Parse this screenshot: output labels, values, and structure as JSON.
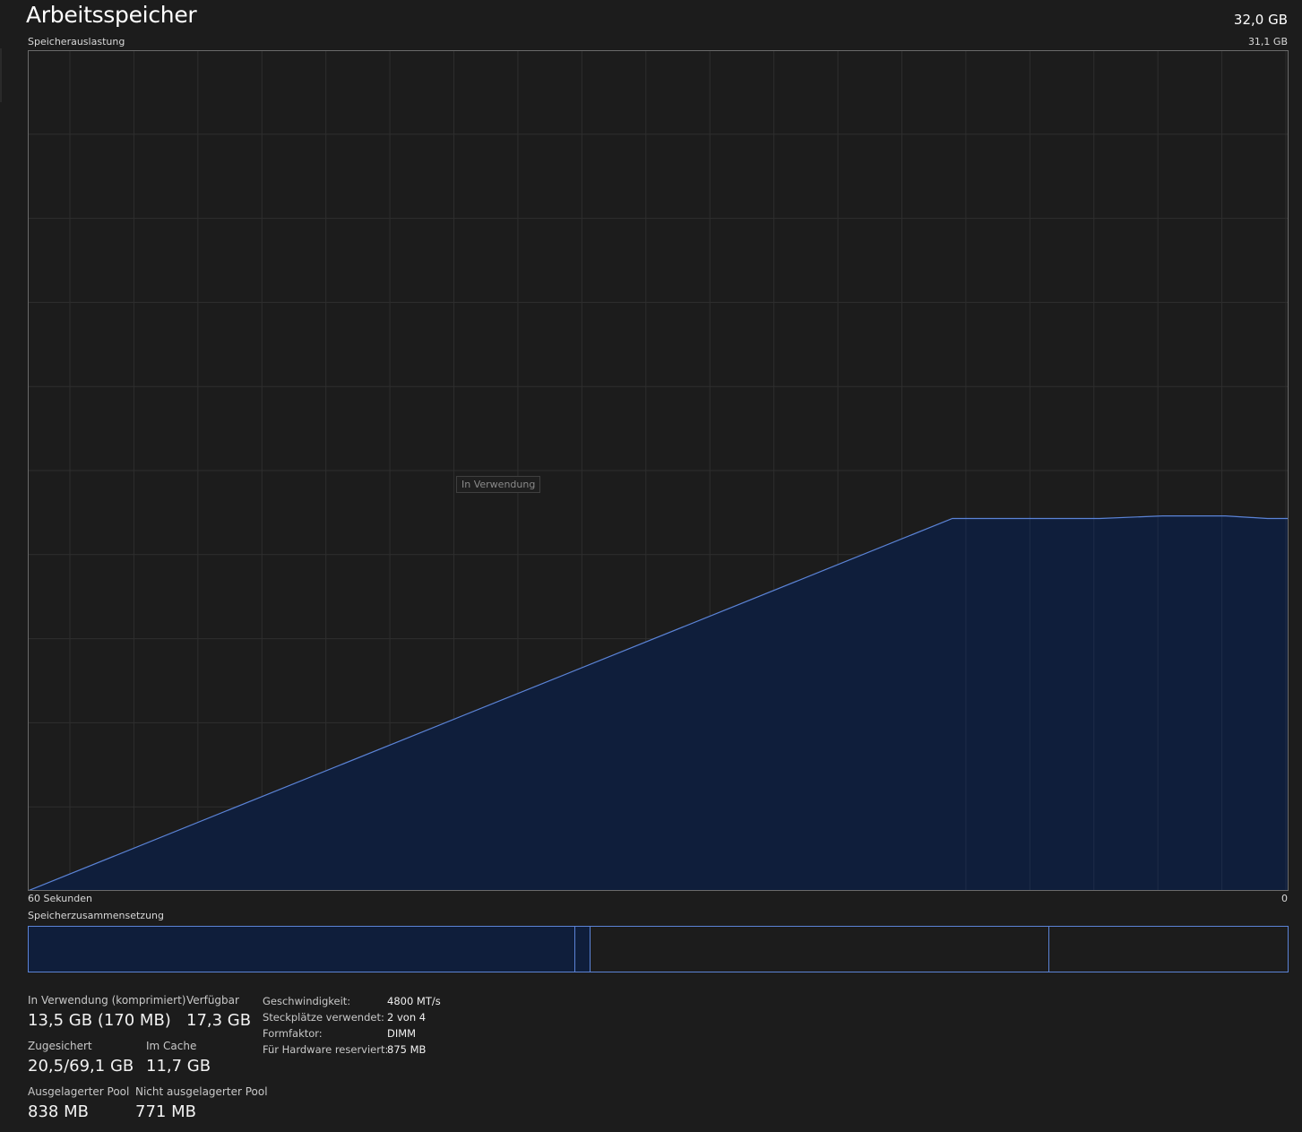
{
  "header": {
    "title": "Arbeitsspeicher",
    "total": "32,0 GB",
    "usage_label": "Speicherauslastung",
    "usage_max": "31,1 GB"
  },
  "graph": {
    "time_left": "60 Sekunden",
    "time_right": "0",
    "tooltip": "In Verwendung",
    "line_color": "#5b83d6",
    "fill_color": "#0f1e3b",
    "grid_color": "#2e2e2e"
  },
  "chart_data": {
    "type": "area",
    "x": [
      60,
      16,
      15,
      12,
      9,
      6,
      3,
      1,
      0
    ],
    "y_fraction_of_max": [
      0.0,
      0.443,
      0.443,
      0.443,
      0.443,
      0.446,
      0.446,
      0.443,
      0.443
    ],
    "ylim": [
      0,
      1
    ],
    "xlim": [
      60,
      0
    ],
    "grid": true
  },
  "composition": {
    "label": "Speicherzusammensetzung",
    "segments_fraction": [
      0.434,
      0.012,
      0.365,
      0.189
    ]
  },
  "stats": {
    "in_use_label": "In Verwendung (komprimiert)",
    "in_use_value": "13,5 GB (170 MB)",
    "available_label": "Verfügbar",
    "available_value": "17,3 GB",
    "committed_label": "Zugesichert",
    "committed_value": "20,5/69,1 GB",
    "cached_label": "Im Cache",
    "cached_value": "11,7 GB",
    "paged_label": "Ausgelagerter Pool",
    "paged_value": "838 MB",
    "nonpaged_label": "Nicht ausgelagerter Pool",
    "nonpaged_value": "771 MB"
  },
  "specs": [
    {
      "label": "Geschwindigkeit:",
      "value": "4800 MT/s"
    },
    {
      "label": "Steckplätze verwendet:",
      "value": "2 von 4"
    },
    {
      "label": "Formfaktor:",
      "value": "DIMM"
    },
    {
      "label": "Für Hardware reserviert:",
      "value": "875 MB"
    }
  ]
}
